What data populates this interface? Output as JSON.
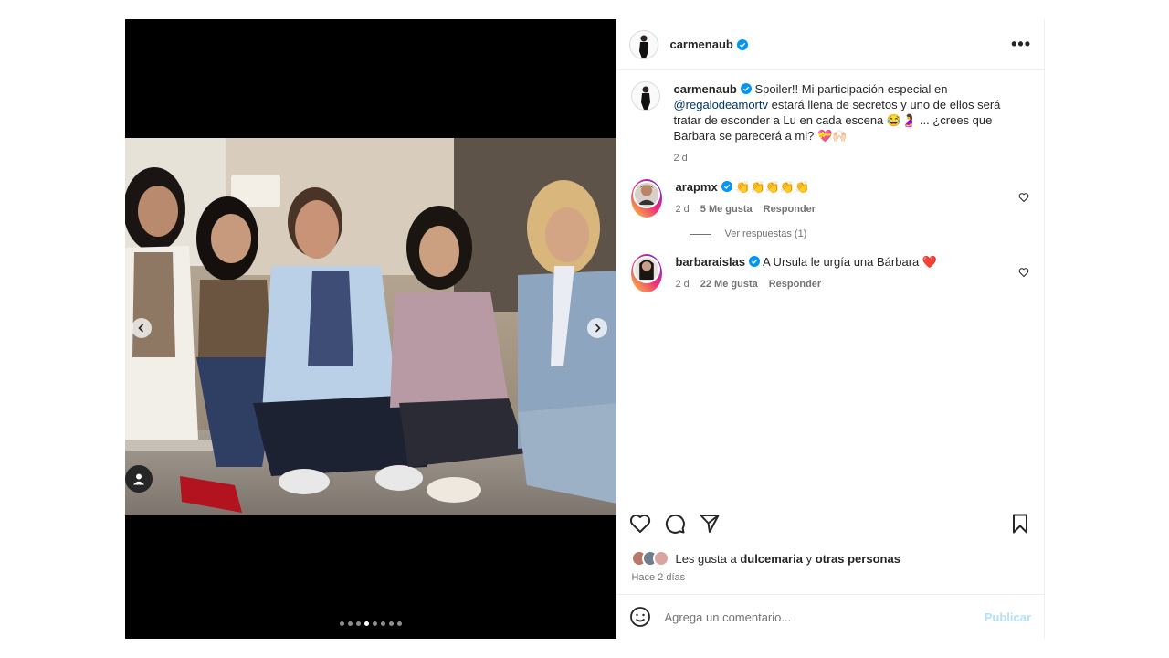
{
  "post": {
    "author": "carmenaub",
    "caption_mention": "@regalodeamortv",
    "caption_part1": "Spoiler!! Mi participación especial en",
    "caption_part2": "estará llena de secretos y uno de ellos será tratar de esconder a Lu en cada escena 😂🤰 ... ¿crees que Barbara se parecerá a mi? 💝🙌🏻",
    "caption_time": "2 d",
    "carousel": {
      "total": 8,
      "active_index": 4
    }
  },
  "comments": [
    {
      "user": "arapmx",
      "text": "👏👏👏👏👏",
      "time": "2 d",
      "likes": "5 Me gusta",
      "reply": "Responder",
      "view_replies": "Ver respuestas (1)"
    },
    {
      "user": "barbaraislas",
      "text": "A Ursula le urgía una Bárbara ❤️",
      "time": "2 d",
      "likes": "22 Me gusta",
      "reply": "Responder"
    }
  ],
  "likes": {
    "prefix": "Les gusta a",
    "user": "dulcemaria",
    "connector": "y",
    "others": "otras personas"
  },
  "posted": "Hace 2 días",
  "add_comment": {
    "placeholder": "Agrega un comentario...",
    "publish": "Publicar"
  },
  "colors": {
    "verified": "#0095f6",
    "link": "#00376b",
    "publish_disabled": "#b2dffc"
  }
}
